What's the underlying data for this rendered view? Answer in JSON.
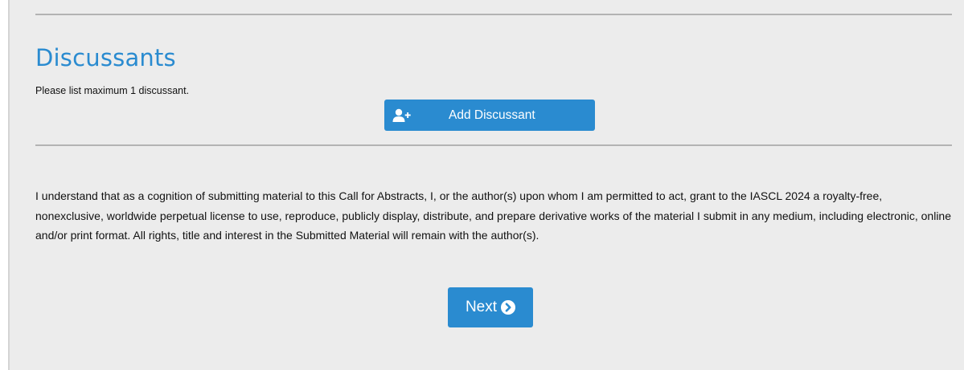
{
  "section": {
    "title": "Discussants",
    "instructions": "Please list maximum 1 discussant."
  },
  "add_button": {
    "label": "Add Discussant",
    "icon": "user-plus-icon"
  },
  "license_text": "I understand that as a cognition of submitting material to this Call for Abstracts, I, or the author(s) upon whom I am permitted to act, grant to the IASCL 2024 a royalty-free, nonexclusive, worldwide perpetual license to use, reproduce, publicly display, distribute, and prepare derivative works of the material I submit in any medium, including electronic, online and/or print format. All rights, title and interest in the Submitted Material will remain with the author(s).",
  "next_button": {
    "label": "Next",
    "icon": "chevron-circle-right-icon"
  },
  "colors": {
    "accent": "#2a8bd0",
    "background": "#ececec",
    "divider": "#b3b3b3",
    "text": "#111111"
  }
}
